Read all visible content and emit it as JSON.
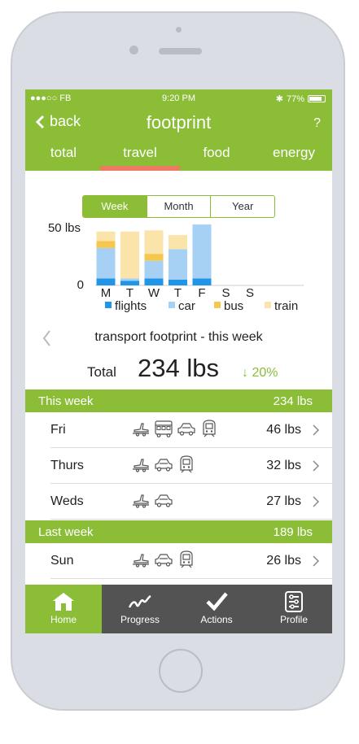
{
  "status": {
    "carrier": "●●●○○ FB",
    "time": "9:20 PM",
    "battery": "77%"
  },
  "nav": {
    "back_label": "back",
    "title": "footprint",
    "help": "?"
  },
  "tabs": [
    {
      "label": "total"
    },
    {
      "label": "travel"
    },
    {
      "label": "food"
    },
    {
      "label": "energy"
    }
  ],
  "active_tab": "travel",
  "segments": [
    "Week",
    "Month",
    "Year"
  ],
  "selected_segment": "Week",
  "chart_data": {
    "type": "bar",
    "stacked": true,
    "categories": [
      "M",
      "T",
      "W",
      "T",
      "F",
      "S",
      "S"
    ],
    "ylabels": [
      "50 lbs",
      "0"
    ],
    "ylim": [
      0,
      50
    ],
    "series": [
      {
        "name": "flights",
        "color": "#2196e8",
        "values": [
          6,
          4,
          6,
          5,
          6,
          0,
          0
        ]
      },
      {
        "name": "car",
        "color": "#a6d0f4",
        "values": [
          26,
          2,
          15,
          26,
          46,
          0,
          0
        ]
      },
      {
        "name": "bus",
        "color": "#f6c74e",
        "values": [
          6,
          0,
          6,
          0,
          0,
          0,
          0
        ]
      },
      {
        "name": "train",
        "color": "#fbe4a9",
        "values": [
          8,
          40,
          20,
          12,
          0,
          0,
          0
        ]
      }
    ]
  },
  "subtitle": "transport footprint - this week",
  "total": {
    "label": "Total",
    "value": "234 lbs",
    "change": "↓ 20%"
  },
  "this_week": {
    "label": "This week",
    "total": "234 lbs",
    "rows": [
      {
        "day": "Fri",
        "amount": "46 lbs",
        "icons": [
          "plane-icon",
          "bus-icon",
          "car-icon",
          "train-icon"
        ]
      },
      {
        "day": "Thurs",
        "amount": "32 lbs",
        "icons": [
          "plane-icon",
          "car-icon",
          "train-icon"
        ]
      },
      {
        "day": "Weds",
        "amount": "27 lbs",
        "icons": [
          "plane-icon",
          "car-icon"
        ]
      }
    ]
  },
  "last_week": {
    "label": "Last week",
    "total": "189 lbs",
    "rows": [
      {
        "day": "Sun",
        "amount": "26 lbs",
        "icons": [
          "plane-icon",
          "car-icon",
          "train-icon"
        ]
      }
    ]
  },
  "tabbar": [
    {
      "label": "Home",
      "icon": "home-icon"
    },
    {
      "label": "Progress",
      "icon": "progress-icon"
    },
    {
      "label": "Actions",
      "icon": "checkmark-icon"
    },
    {
      "label": "Profile",
      "icon": "profile-icon"
    }
  ],
  "colors": {
    "accent": "#8bbd37",
    "tab_indicator": "#ee7a63",
    "tabbar": "#535353"
  }
}
